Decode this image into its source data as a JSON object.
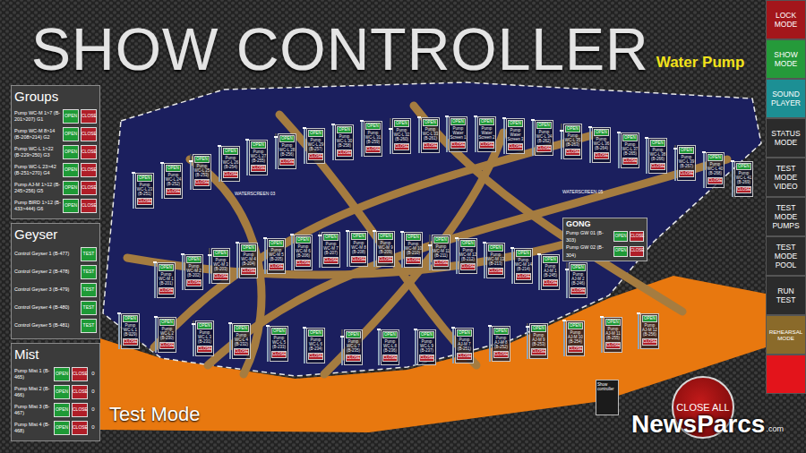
{
  "header": {
    "title": "SHOW CONTROLLER",
    "subtitle": "Water Pump"
  },
  "labels": {
    "open": "OPEN",
    "close": "CLOSE",
    "test": "TEST"
  },
  "mode_buttons": [
    {
      "label": "LOCK MODE",
      "color": "#a3161b"
    },
    {
      "label": "SHOW MODE",
      "color": "#259a3a"
    },
    {
      "label": "SOUND PLAYER",
      "color": "#1c8f94"
    },
    {
      "label": "STATUS MODE",
      "color": "#2b2b2b"
    },
    {
      "label": "TEST MODE VIDEO",
      "color": "#2b2b2b"
    },
    {
      "label": "TEST MODE PUMPS",
      "color": "#2b2b2b"
    },
    {
      "label": "TEST MODE POOL",
      "color": "#2b2b2b"
    },
    {
      "label": "RUN TEST",
      "color": "#2b2b2b"
    },
    {
      "label": "REHEARSAL MODE",
      "color": "#8a6a2a"
    },
    {
      "label": "",
      "color": "#e3141b"
    }
  ],
  "groups": {
    "title": "Groups",
    "rows": [
      {
        "label": "Pump WC-M 1>7 (B-201>207) G1"
      },
      {
        "label": "Pump WC-M 8>14 (B-208>214) G2"
      },
      {
        "label": "Pump WC-L 1>22 (B-229>250) G3"
      },
      {
        "label": "Pump WC-L 23>42 (B-251>270) G4"
      },
      {
        "label": "Pump AJ-M 1>12 (B-245>256) G5"
      },
      {
        "label": "Pump BIRD 1>12 (B-433>444) G6"
      }
    ]
  },
  "geyser": {
    "title": "Geyser",
    "rows": [
      {
        "label": "Control Geyser 1 (B-477)"
      },
      {
        "label": "Control Geyser 2 (B-478)"
      },
      {
        "label": "Control Geyser 3 (B-479)"
      },
      {
        "label": "Control Geyser 4 (B-480)"
      },
      {
        "label": "Control Geyser 5 (B-481)"
      }
    ]
  },
  "mist": {
    "title": "Mist",
    "rows": [
      {
        "label": "Pump Mist 1 (B-465)",
        "value": "0"
      },
      {
        "label": "Pump Mist 2 (B-466)",
        "value": "0"
      },
      {
        "label": "Pump Mist 3 (B-467)",
        "value": "0"
      },
      {
        "label": "Pump Mist 4 (B-468)",
        "value": "0"
      }
    ]
  },
  "pool": {
    "rows": [
      [
        {
          "label": "Pump WC-L 23 (B-251)",
          "level": 1
        },
        {
          "label": "Pump WC-L 24 (B-252)",
          "level": 1
        },
        {
          "label": "Pump WC-L 25 (B-253)",
          "level": 0.8
        },
        {
          "label": "Pump WC-L 26 (B-254)",
          "level": 1
        },
        {
          "label": "Pump WC-L 27 (B-255)",
          "level": 1
        },
        {
          "label": "Pump WC-L 28 (B-256)",
          "level": 0.9
        },
        {
          "label": "Pump WC-L 29 (B-257)",
          "level": 1
        },
        {
          "label": "Pump WC-L 30 (B-258)",
          "level": 1
        },
        {
          "label": "Pump WC-L 31 (B-259)",
          "level": 1
        },
        {
          "label": "Pump WC-L 32 (B-260)",
          "level": 0.7
        },
        {
          "label": "Pump WC-L 33 (B-261)",
          "level": 1
        },
        {
          "label": "Pump Water Screen 1",
          "level": 1
        },
        {
          "label": "Pump Water Screen 2",
          "level": 1
        },
        {
          "label": "Pump Water Screen 3",
          "level": 1
        },
        {
          "label": "Pump WC-L 34 (B-262)",
          "level": 1
        },
        {
          "label": "Pump WC-L 35 (B-263)",
          "level": 0.8
        },
        {
          "label": "Pump WC-L 36 (B-264)",
          "level": 1
        },
        {
          "label": "Pump WC-L 37 (B-265)",
          "level": 1
        },
        {
          "label": "Pump WC-L 38 (B-266)",
          "level": 1
        },
        {
          "label": "Pump WC-L 39 (B-267)",
          "level": 0.9
        },
        {
          "label": "Pump WC-L 40 (B-268)",
          "level": 1
        },
        {
          "label": "Pump WC-L 41 (B-269)",
          "level": 1
        }
      ],
      [
        {
          "label": "Pump WC-M 1 (B-201)",
          "level": 1
        },
        {
          "label": "Pump WC-M 2 (B-202)",
          "level": 1
        },
        {
          "label": "Pump WC-M 3 (B-203)",
          "level": 0.8
        },
        {
          "label": "Pump WC-M 4 (B-204)",
          "level": 1
        },
        {
          "label": "Pump WC-M 5 (B-205)",
          "level": 1
        },
        {
          "label": "Pump WC-M 6 (B-206)",
          "level": 1
        },
        {
          "label": "Pump WC-M 7 (B-207)",
          "level": 0.9
        },
        {
          "label": "Pump WC-M 8 (B-208)",
          "level": 1
        },
        {
          "label": "Pump WC-M 9 (B-209)",
          "level": 1
        },
        {
          "label": "Pump WC-M 10 (B-210)",
          "level": 1
        },
        {
          "label": "Pump WC-M 11 (B-211)",
          "level": 0.7
        },
        {
          "label": "Pump WC-M 12 (B-212)",
          "level": 1
        },
        {
          "label": "Pump WC-M 13 (B-213)",
          "level": 1
        },
        {
          "label": "Pump WC-M 14 (B-214)",
          "level": 1
        },
        {
          "label": "Pump AJ-M 1 (B-245)",
          "level": 1
        },
        {
          "label": "Pump AJ-M 2 (B-246)",
          "level": 0.8
        }
      ],
      [
        {
          "label": "Pump WC-L 1 (B-229)",
          "level": 1
        },
        {
          "label": "Pump WC-L 2 (B-230)",
          "level": 1
        },
        {
          "label": "Pump WC-L 3 (B-231)",
          "level": 0.9
        },
        {
          "label": "Pump WC-L 4 (B-232)",
          "level": 1
        },
        {
          "label": "Pump WC-L 5 (B-233)",
          "level": 1
        },
        {
          "label": "Pump WC-L 6 (B-234)",
          "level": 1
        },
        {
          "label": "Pump WC-L 7 (B-235)",
          "level": 0.8
        },
        {
          "label": "Pump WC-L 8 (B-236)",
          "level": 1
        },
        {
          "label": "Pump WC-L 9 (B-237)",
          "level": 1
        },
        {
          "label": "Pump AJ-M 7 (B-251)",
          "level": 1
        },
        {
          "label": "Pump AJ-M 8 (B-252)",
          "level": 1
        },
        {
          "label": "Pump AJ-M 9 (B-253)",
          "level": 0.9
        },
        {
          "label": "Pump AJ-M 10 (B-254)",
          "level": 1
        },
        {
          "label": "Pump AJ-M 11 (B-255)",
          "level": 1
        },
        {
          "label": "Pump AJ-M 12 (B-256)",
          "level": 1
        }
      ]
    ],
    "area_labels": [
      "WATERSCREEN 03",
      "WATERSCREEN 05"
    ],
    "gong": {
      "title": "GONG",
      "rows": [
        {
          "label": "Pump GW 01 (B-303)"
        },
        {
          "label": "Pump GW 02 (B-304)"
        }
      ]
    },
    "mode_text": "Test Mode",
    "close_all": "CLOSE ALL",
    "note": "Show controller"
  },
  "watermark": {
    "brand": "NewsParcs",
    "suffix": ".com"
  }
}
